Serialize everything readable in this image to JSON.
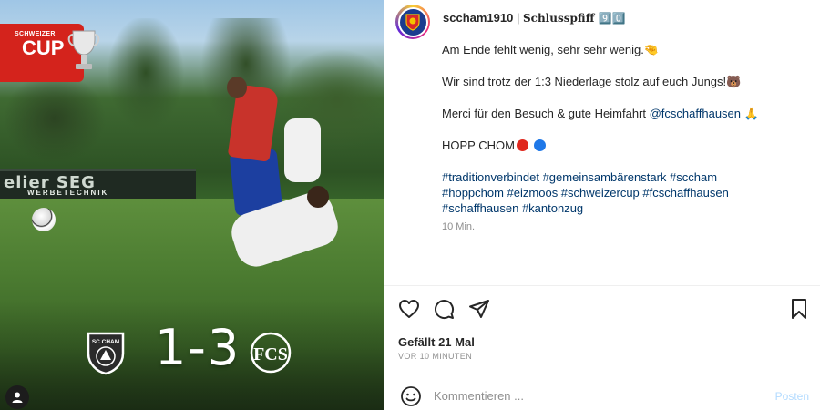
{
  "media": {
    "top_badge_text": "",
    "cup_badge": {
      "small": "SCHWEIZER",
      "big": "CUP"
    },
    "board_text": "elier SEG",
    "board_subtext": "WERBETECHNIK",
    "score": "1-3",
    "home_crest": {
      "icon": "sc-cham-crest-icon",
      "text": "SC CHAM"
    },
    "away_crest": {
      "icon": "fc-schaffhausen-crest-icon",
      "text": "FCS"
    }
  },
  "post": {
    "username": "sccham1910",
    "separator": "|",
    "title": "Schlusspfiff 9️⃣0️⃣",
    "caption": {
      "line1": "Am Ende fehlt wenig, sehr sehr wenig.🤏",
      "line2": "Wir sind trotz der 1:3 Niederlage stolz auf euch Jungs!🐻",
      "line3_before": "Merci für den Besuch & gute Heimfahrt ",
      "line3_mention": "@fcschaffhausen",
      "line3_after": " 🙏",
      "line4": "HOPP CHOM",
      "hashtags_1": "#traditionverbindet #gemeinsambärenstark #sccham",
      "hashtags_2": "#hoppchom #eizmoos #schweizercup #fcschaffhausen",
      "hashtags_3": "#schaffhausen #kantonzug",
      "time": "10 Min."
    },
    "likes": "Gefällt 21 Mal",
    "posted_ago": "VOR 10 MINUTEN",
    "comment_placeholder": "Kommentieren ...",
    "post_label": "Posten"
  },
  "colors": {
    "link": "#00376b",
    "cup_red": "#d4231c",
    "post_button_disabled": "#b3dbff",
    "dot_red": "#e0281e",
    "dot_blue": "#1f78e8"
  },
  "icons": [
    "heart-icon",
    "comment-icon",
    "share-icon",
    "bookmark-icon",
    "emoji-icon",
    "trophy-icon",
    "avatar-icon"
  ]
}
